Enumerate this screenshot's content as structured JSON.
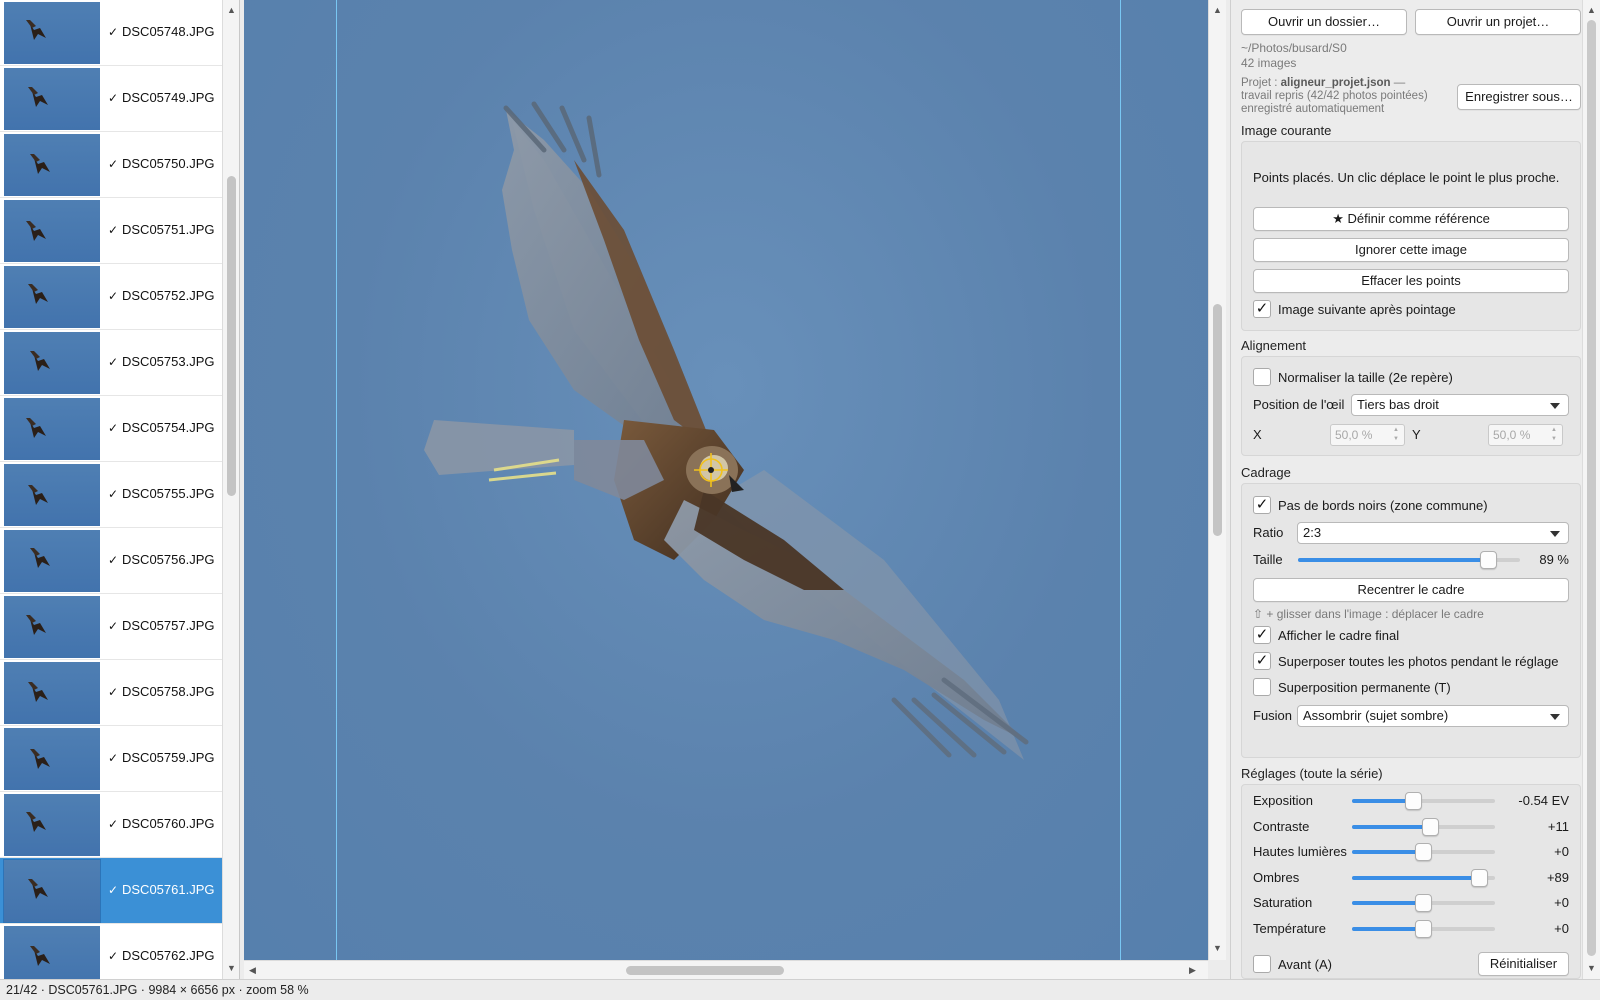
{
  "files": [
    {
      "name": "DSC05748.JPG",
      "checked": "✓",
      "selected": false
    },
    {
      "name": "DSC05749.JPG",
      "checked": "✓",
      "selected": false
    },
    {
      "name": "DSC05750.JPG",
      "checked": "✓",
      "selected": false
    },
    {
      "name": "DSC05751.JPG",
      "checked": "✓",
      "selected": false
    },
    {
      "name": "DSC05752.JPG",
      "checked": "✓",
      "selected": false
    },
    {
      "name": "DSC05753.JPG",
      "checked": "✓",
      "selected": false
    },
    {
      "name": "DSC05754.JPG",
      "checked": "✓",
      "selected": false
    },
    {
      "name": "DSC05755.JPG",
      "checked": "✓",
      "selected": false
    },
    {
      "name": "DSC05756.JPG",
      "checked": "✓",
      "selected": false
    },
    {
      "name": "DSC05757.JPG",
      "checked": "✓",
      "selected": false
    },
    {
      "name": "DSC05758.JPG",
      "checked": "✓",
      "selected": false
    },
    {
      "name": "DSC05759.JPG",
      "checked": "✓",
      "selected": false
    },
    {
      "name": "DSC05760.JPG",
      "checked": "✓",
      "selected": false
    },
    {
      "name": "DSC05761.JPG",
      "checked": "✓",
      "selected": true
    },
    {
      "name": "DSC05762.JPG",
      "checked": "✓",
      "selected": false
    }
  ],
  "colors": {
    "accent": "#3a8ee6",
    "selection": "#3b90d6",
    "sky": "#5f86b1",
    "guide": "#7fd4ff",
    "target": "#f2c21b"
  },
  "top": {
    "open_folder": "Ouvrir un dossier…",
    "open_project": "Ouvrir un projet…",
    "folder_path": "~/Photos/busard/S0",
    "image_count": "42 images",
    "project_prefix": "Projet : ",
    "project_file": "aligneur_projet.json",
    "project_suffix": " —",
    "project_line2": "travail repris (42/42 photos pointées)",
    "project_line3": "enregistré automatiquement",
    "save_as": "Enregistrer sous…"
  },
  "current": {
    "title": "Image courante",
    "hint": "Points placés. Un clic déplace le point le plus proche.",
    "set_reference": "★ Définir comme référence",
    "ignore": "Ignorer cette image",
    "clear_points": "Effacer les points",
    "next_after": "Image suivante après pointage",
    "next_after_checked": "✓"
  },
  "alignment": {
    "title": "Alignement",
    "normalize": "Normaliser la taille (2e repère)",
    "normalize_checked": "",
    "eye_label": "Position de l'œil",
    "eye_value": "Tiers bas droit",
    "x_label": "X",
    "x_value": "50,0 %",
    "y_label": "Y",
    "y_value": "50,0 %"
  },
  "crop": {
    "title": "Cadrage",
    "no_black": "Pas de bords noirs (zone commune)",
    "no_black_checked": "✓",
    "ratio_label": "Ratio",
    "ratio_value": "2:3",
    "size_label": "Taille",
    "size_value": "89 %",
    "size_fraction": 0.89,
    "recenter": "Recentrer le cadre",
    "drag_hint": "⇧ + glisser dans l'image : déplacer le cadre",
    "show_final": "Afficher le cadre final",
    "show_final_checked": "✓",
    "overlay_all": "Superposer toutes les photos pendant le réglage",
    "overlay_all_checked": "✓",
    "permanent": "Superposition permanente (T)",
    "permanent_checked": "",
    "fusion_label": "Fusion",
    "fusion_value": "Assombrir (sujet sombre)"
  },
  "adjust": {
    "title": "Réglages (toute la série)",
    "items": [
      {
        "label": "Exposition",
        "value": "-0.54 EV",
        "fraction": 0.42
      },
      {
        "label": "Contraste",
        "value": "+11",
        "fraction": 0.555
      },
      {
        "label": "Hautes lumières",
        "value": "+0",
        "fraction": 0.5
      },
      {
        "label": "Ombres",
        "value": "+89",
        "fraction": 0.945
      },
      {
        "label": "Saturation",
        "value": "+0",
        "fraction": 0.5
      },
      {
        "label": "Température",
        "value": "+0",
        "fraction": 0.5
      }
    ],
    "before": "Avant (A)",
    "before_checked": "",
    "reset": "Réinitialiser"
  },
  "status": {
    "position": "21/42",
    "file": "DSC05761.JPG",
    "dimensions": "9984 × 6656 px",
    "zoom": "zoom 58 %",
    "sep": " · "
  }
}
